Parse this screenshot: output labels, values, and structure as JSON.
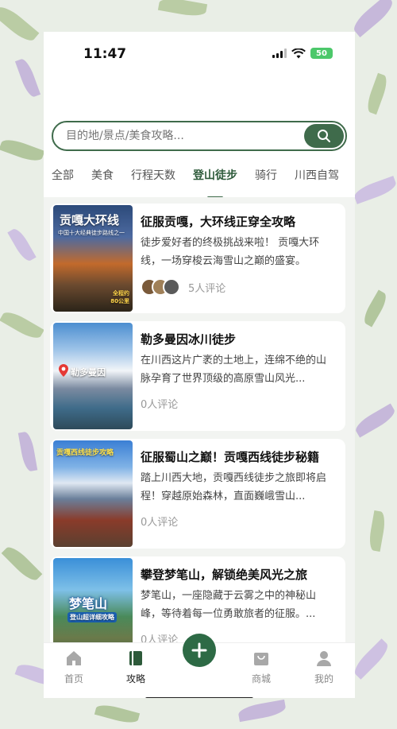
{
  "status": {
    "time": "11:47",
    "battery": "50"
  },
  "search": {
    "placeholder": "目的地/景点/美食攻略..."
  },
  "tabs": [
    {
      "label": "全部"
    },
    {
      "label": "美食"
    },
    {
      "label": "行程天数"
    },
    {
      "label": "登山徒步"
    },
    {
      "label": "骑行"
    },
    {
      "label": "川西自驾"
    }
  ],
  "cards": [
    {
      "title": "征服贡嘎，大环线正穿全攻略",
      "desc": "徒步爱好者的终极挑战来啦！ 贡嘎大环线，一场穿梭云海雪山之巅的盛宴。",
      "meta": "5人评论",
      "thumb_title": "贡嘎大环线",
      "thumb_sub": "中国十大经典徒步路线之一",
      "thumb_note": "全程约\n80公里"
    },
    {
      "title": "勒多曼因冰川徒步",
      "desc": "在川西这片广袤的土地上，连绵不绝的山脉孕育了世界顶级的高原雪山风光...",
      "meta": "0人评论",
      "thumb_title": "勒多曼因"
    },
    {
      "title": "征服蜀山之巅！贡嘎西线徒步秘籍",
      "desc": "踏上川西大地，贡嘎西线徒步之旅即将启程！穿越原始森林，直面巍峨雪山...",
      "meta": "0人评论",
      "thumb_title": "贡嘎西线徒步攻略"
    },
    {
      "title": "攀登梦笔山，解锁绝美风光之旅",
      "desc": "梦笔山，一座隐藏于云雾之中的神秘山峰，等待着每一位勇敢旅者的征服。...",
      "meta": "0人评论",
      "thumb_title": "梦笔山",
      "thumb_sub": "登山超详细攻略"
    }
  ],
  "nav": {
    "home": "首页",
    "guide": "攻略",
    "shop": "商城",
    "mine": "我的"
  },
  "colors": {
    "accent": "#3f6b4b",
    "fab": "#2d6a45"
  }
}
